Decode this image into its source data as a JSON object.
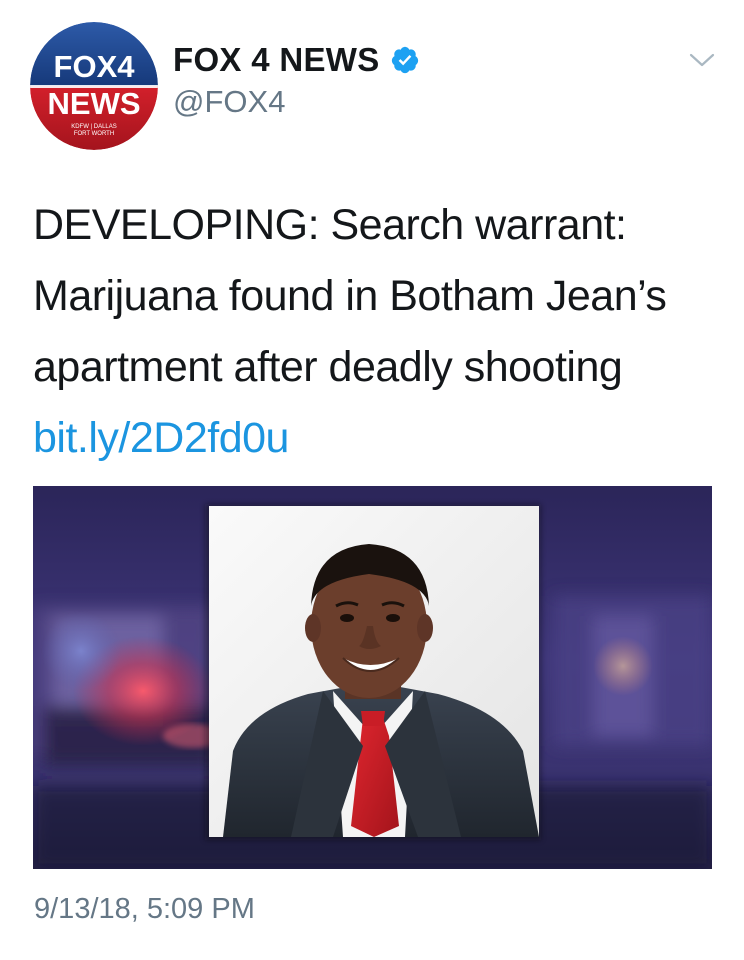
{
  "account": {
    "display_name": "FOX 4 NEWS",
    "handle": "@FOX4",
    "verified": true,
    "avatar": {
      "logo_top": "FOX4",
      "logo_bottom": "NEWS",
      "logo_sub_1": "KDFW | DALLAS",
      "logo_sub_2": "FORT WORTH"
    }
  },
  "tweet": {
    "text": "DEVELOPING: Search warrant: Marijuana found in Botham Jean’s apartment after deadly shooting",
    "link": "bit.ly/2D2fd0u",
    "timestamp": "9/13/18, 5:09 PM"
  },
  "media": {
    "description_icon": "photo-icon"
  },
  "icons": {
    "menu": "chevron-down-icon",
    "verified": "verified-badge-icon"
  },
  "colors": {
    "link": "#1b95e0",
    "verified": "#1da1f2",
    "secondary_text": "#657786",
    "primary_text": "#14171a"
  }
}
